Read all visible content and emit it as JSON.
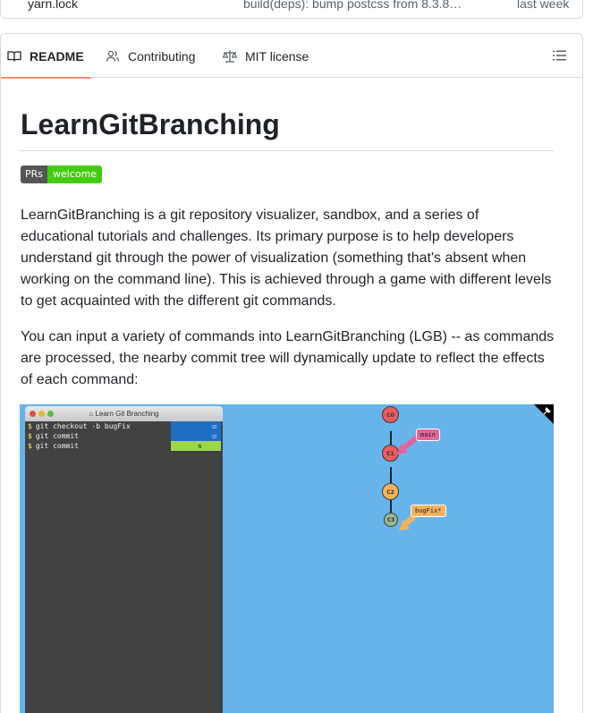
{
  "file_row": {
    "name": "yarn.lock",
    "message": "build(deps): bump postcss from 8.3.8…",
    "date": "last week"
  },
  "tabs": [
    {
      "label": "README",
      "icon": "book-icon",
      "active": true
    },
    {
      "label": "Contributing",
      "icon": "people-icon",
      "active": false
    },
    {
      "label": "MIT license",
      "icon": "law-icon",
      "active": false
    }
  ],
  "readme": {
    "title": "LearnGitBranching",
    "badge_left": "PRs",
    "badge_right": "welcome",
    "para1": "LearnGitBranching is a git repository visualizer, sandbox, and a series of educational tutorials and challenges. Its primary purpose is to help developers understand git through the power of visualization (something that's absent when working on the command line). This is achieved through a game with different levels to get acquainted with the different git commands.",
    "para2": "You can input a variety of commands into LearnGitBranching (LGB) -- as commands are processed, the nearby commit tree will dynamically update to reflect the effects of each command:"
  },
  "demo": {
    "window_title": "Learn Git Branching",
    "commands": [
      "git checkout -b bugFix",
      "git commit",
      "git commit"
    ],
    "nodes": [
      "C0",
      "C1",
      "C2",
      "C3"
    ],
    "branches": [
      "main",
      "bugFix*"
    ],
    "colors": {
      "background": "#67b4ec",
      "terminal": "#424242",
      "done": "#1f6fc4",
      "running": "#9ed64a",
      "main": "#e2659c",
      "bugfix": "#f5b359",
      "node_red": "#ec5b5b",
      "node_orange": "#f2b35b",
      "node_green": "#99b899"
    }
  }
}
